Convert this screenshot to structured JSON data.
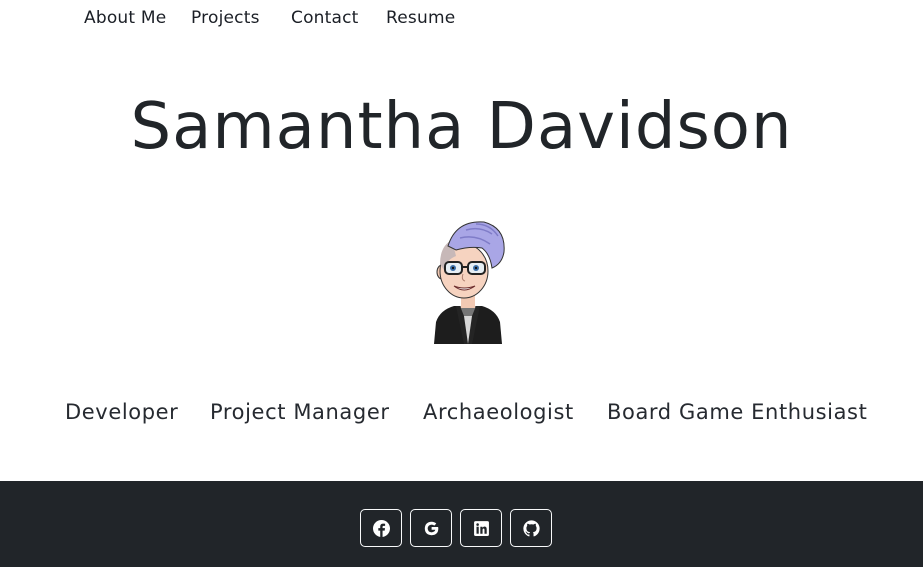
{
  "nav": {
    "items": [
      {
        "label": "About Me"
      },
      {
        "label": "Projects"
      },
      {
        "label": "Contact"
      },
      {
        "label": "Resume"
      }
    ]
  },
  "hero": {
    "name": "Samantha Davidson",
    "avatar_icon": "bitmoji-avatar-icon"
  },
  "roles": [
    {
      "label": "Developer"
    },
    {
      "label": "Project Manager"
    },
    {
      "label": "Archaeologist"
    },
    {
      "label": "Board Game Enthusiast"
    }
  ],
  "footer": {
    "background": "#212529",
    "social": [
      {
        "icon": "facebook-icon"
      },
      {
        "icon": "google-icon"
      },
      {
        "icon": "linkedin-icon"
      },
      {
        "icon": "github-icon"
      }
    ]
  }
}
